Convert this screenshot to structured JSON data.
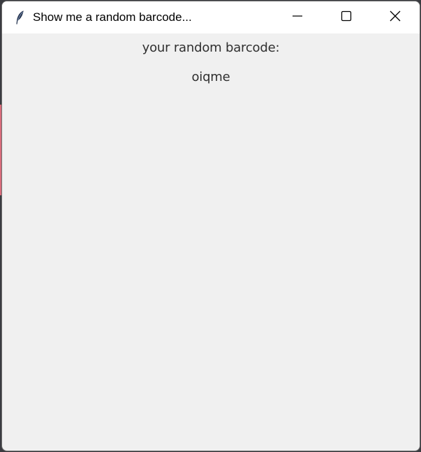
{
  "window": {
    "title": "Show me a random barcode...",
    "icon": "feather-icon",
    "controls": {
      "minimize": "minimize-icon",
      "maximize": "maximize-icon",
      "close": "close-icon"
    }
  },
  "content": {
    "heading": "your random barcode:",
    "barcode_value": "oiqme"
  },
  "colors": {
    "window_background": "#f0f0f0",
    "titlebar_background": "#ffffff",
    "text": "#2f2f2f",
    "desktop": "#3a3b40",
    "desktop_accent": "#d96b7a"
  }
}
